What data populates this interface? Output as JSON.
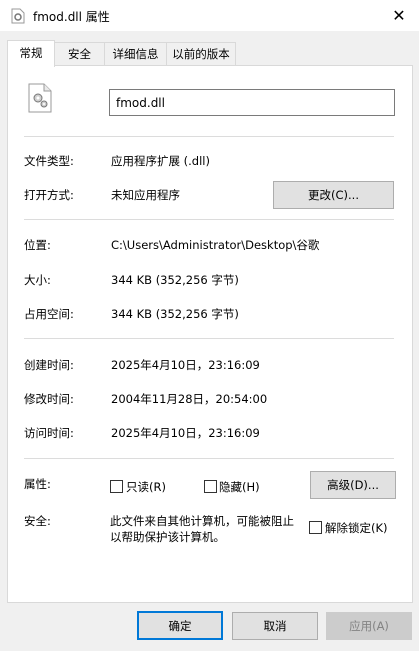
{
  "window": {
    "title": "fmod.dll 属性",
    "close_glyph": "✕"
  },
  "tabs": [
    "常规",
    "安全",
    "详细信息",
    "以前的版本"
  ],
  "general": {
    "file_name": "fmod.dll",
    "file_type_label": "文件类型:",
    "file_type_value": "应用程序扩展 (.dll)",
    "opens_with_label": "打开方式:",
    "opens_with_value": "未知应用程序",
    "change_button": "更改(C)...",
    "location_label": "位置:",
    "location_value": "C:\\Users\\Administrator\\Desktop\\谷歌",
    "size_label": "大小:",
    "size_value": "344 KB (352,256 字节)",
    "size_on_disk_label": "占用空间:",
    "size_on_disk_value": "344 KB (352,256 字节)",
    "created_label": "创建时间:",
    "created_value": "2025年4月10日，23:16:09",
    "modified_label": "修改时间:",
    "modified_value": "2004年11月28日，20:54:00",
    "accessed_label": "访问时间:",
    "accessed_value": "2025年4月10日，23:16:09",
    "attributes_label": "属性:",
    "readonly_label": "只读(R)",
    "hidden_label": "隐藏(H)",
    "advanced_button": "高级(D)...",
    "security_label": "安全:",
    "security_text_line1": "此文件来自其他计算机，可能被阻止",
    "security_text_line2": "以帮助保护该计算机。",
    "unblock_label": "解除锁定(K)"
  },
  "footer": {
    "ok": "确定",
    "cancel": "取消",
    "apply": "应用(A)"
  }
}
